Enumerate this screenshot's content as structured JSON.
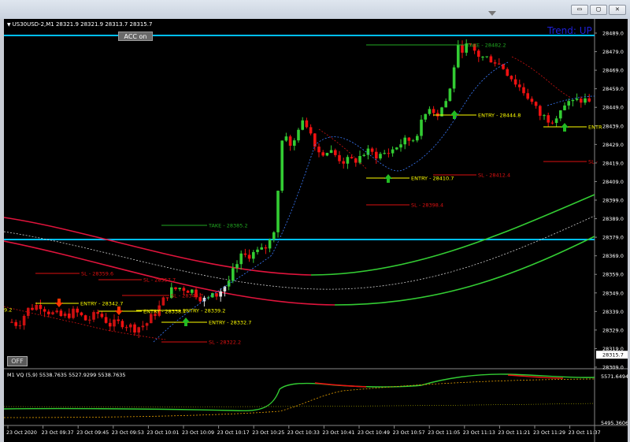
{
  "window": {
    "min_label": "▭",
    "restore_label": "▢",
    "close_label": "✕"
  },
  "chart": {
    "symbol_info": "US30USD-2,M1  28321.9 28321.9 28313.7 28315.7",
    "trend_label": "Trend: UP",
    "acc_button": "ACC on",
    "off_button": "OFF",
    "current_price": "28315.7",
    "price_axis": [
      "28489.0",
      "28479.0",
      "28469.0",
      "28459.0",
      "28449.0",
      "28439.0",
      "28429.0",
      "28419.0",
      "28409.0",
      "28399.0",
      "28389.0",
      "28379.0",
      "28369.0",
      "28359.0",
      "28349.0",
      "28339.0",
      "28329.0",
      "28319.0",
      "28309.0"
    ],
    "time_axis": [
      "23 Oct 2020",
      "23 Oct 09:37",
      "23 Oct 09:45",
      "23 Oct 09:53",
      "23 Oct 10:01",
      "23 Oct 10:09",
      "23 Oct 10:17",
      "23 Oct 10:25",
      "23 Oct 10:33",
      "23 Oct 10:41",
      "23 Oct 10:49",
      "23 Oct 10:57",
      "23 Oct 11:05",
      "23 Oct 11:13",
      "23 Oct 11:21",
      "23 Oct 11:29",
      "23 Oct 11:37"
    ],
    "levels": [
      {
        "text": "TAKE - 28482.2",
        "color": "#22aa22"
      },
      {
        "text": "ENTRY - 28444.8",
        "color": "#ffff00"
      },
      {
        "text": "ENTRY - 28410.7",
        "color": "#ffff00"
      },
      {
        "text": "SL - 28412.4",
        "color": "#dd1111"
      },
      {
        "text": "SL - 28398.4",
        "color": "#dd1111"
      },
      {
        "text": "TAKE - 28385.2",
        "color": "#22aa22"
      },
      {
        "text": "SL - 28359.6",
        "color": "#dd1111"
      },
      {
        "text": "SL - 28357.7",
        "color": "#dd1111"
      },
      {
        "text": "SL - 28348.7",
        "color": "#dd1111"
      },
      {
        "text": "ENTRY - 28342.7",
        "color": "#ffff00"
      },
      {
        "text": "ENTRY - 28339.2",
        "color": "#ffff00"
      },
      {
        "text": "ENTRY - 28338.7",
        "color": "#ffff00"
      },
      {
        "text": "ENTRY - 28332.7",
        "color": "#ffff00"
      },
      {
        "text": "SL - 28322.2",
        "color": "#dd1111"
      },
      {
        "text": "ENTR",
        "color": "#ffff00"
      },
      {
        "text": "SL -",
        "color": "#dd1111"
      },
      {
        "text": "9.2",
        "color": "#ffff00"
      }
    ],
    "indicator": {
      "label": "M1 VQ (5,9) 5538.7635 5527.9299 5538.7635",
      "axis_top": "5571.6494",
      "axis_bottom": "5495.3606"
    }
  },
  "colors": {
    "background": "#000000",
    "bull": "#33cc33",
    "bear": "#ee1111",
    "band_red": "#e0143c",
    "band_green": "#33cc33",
    "level_line": "#00bfff",
    "trend": "#1e20d8"
  }
}
